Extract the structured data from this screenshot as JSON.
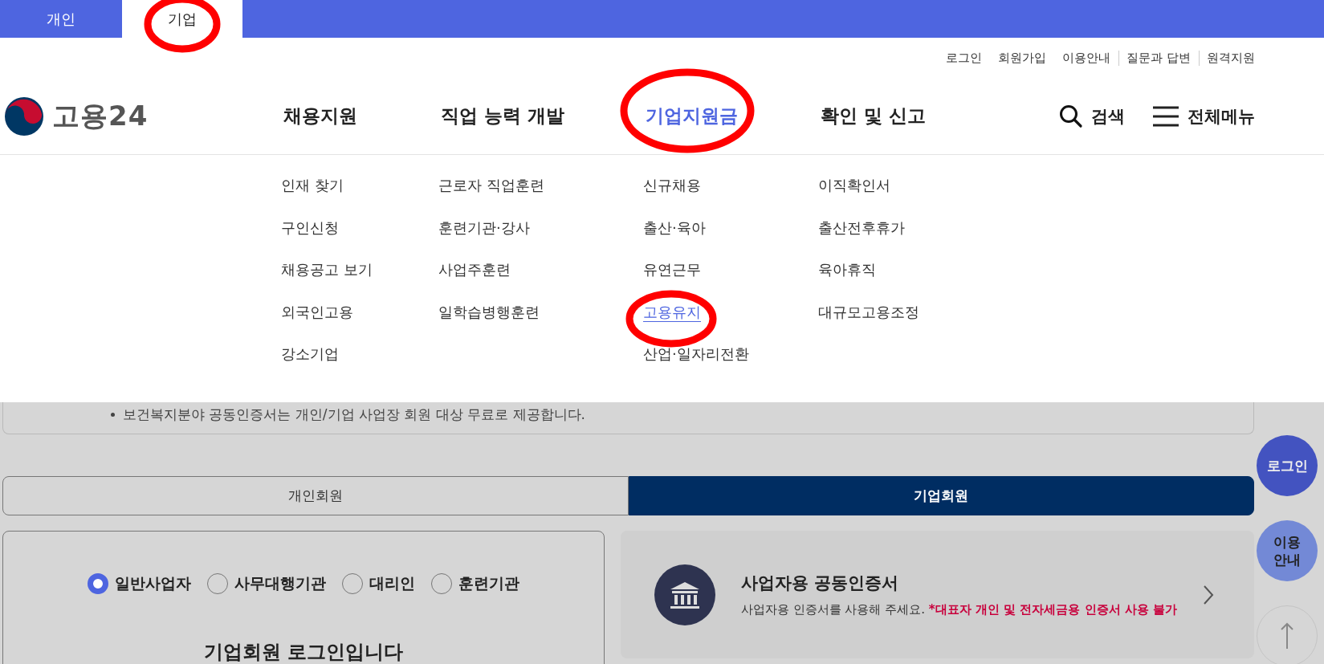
{
  "top_tabs": [
    {
      "label": "개인",
      "selected": false
    },
    {
      "label": "기업",
      "selected": true
    }
  ],
  "utility_links": [
    {
      "label": "로그인",
      "separated": false
    },
    {
      "label": "회원가입",
      "separated": false
    },
    {
      "label": "이용안내",
      "separated": false
    },
    {
      "label": "질문과 답변",
      "separated": true
    },
    {
      "label": "원격지원",
      "separated": true
    }
  ],
  "logo": {
    "text": "고용24"
  },
  "main_nav": [
    {
      "label": "채용지원",
      "selected": false
    },
    {
      "label": "직업 능력 개발",
      "selected": false
    },
    {
      "label": "기업지원금",
      "selected": true
    },
    {
      "label": "확인 및 신고",
      "selected": false
    }
  ],
  "search": {
    "label": "검색"
  },
  "all_menu": {
    "label": "전체메뉴"
  },
  "mega_menu": [
    {
      "items": [
        {
          "label": "인재 찾기",
          "selected": false
        },
        {
          "label": "구인신청",
          "selected": false
        },
        {
          "label": "채용공고 보기",
          "selected": false
        },
        {
          "label": "외국인고용",
          "selected": false
        },
        {
          "label": "강소기업",
          "selected": false
        }
      ]
    },
    {
      "items": [
        {
          "label": "근로자 직업훈련",
          "selected": false
        },
        {
          "label": "훈련기관·강사",
          "selected": false
        },
        {
          "label": "사업주훈련",
          "selected": false
        },
        {
          "label": "일학습병행훈련",
          "selected": false
        }
      ]
    },
    {
      "items": [
        {
          "label": "신규채용",
          "selected": false
        },
        {
          "label": "출산·육아",
          "selected": false
        },
        {
          "label": "유연근무",
          "selected": false
        },
        {
          "label": "고용유지",
          "selected": true
        },
        {
          "label": "산업·일자리전환",
          "selected": false
        }
      ]
    },
    {
      "items": [
        {
          "label": "이직확인서",
          "selected": false
        },
        {
          "label": "출산전후휴가",
          "selected": false
        },
        {
          "label": "육아휴직",
          "selected": false
        },
        {
          "label": "대규모고용조정",
          "selected": false
        }
      ]
    }
  ],
  "notice": "보건복지분야 공동인증서는 개인/기업 사업장 회원 대상 무료로 제공합니다.",
  "member_tabs": [
    {
      "label": "개인회원",
      "selected": false
    },
    {
      "label": "기업회원",
      "selected": true
    }
  ],
  "member_types": [
    {
      "label": "일반사업자",
      "selected": true
    },
    {
      "label": "사무대행기관",
      "selected": false
    },
    {
      "label": "대리인",
      "selected": false
    },
    {
      "label": "훈련기관",
      "selected": false
    }
  ],
  "login_heading": "기업회원 로그인입니다",
  "cert_card": {
    "title": "사업자용 공동인증서",
    "description": "사업자용 인증서를 사용해 주세요.",
    "warning": "*대표자 개인 및 전자세금용 인증서 사용 불가"
  },
  "floating_buttons": [
    {
      "label": "로그인",
      "kind": "login"
    },
    {
      "label": "이용안내",
      "kind": "guide"
    },
    {
      "kind": "top"
    }
  ]
}
